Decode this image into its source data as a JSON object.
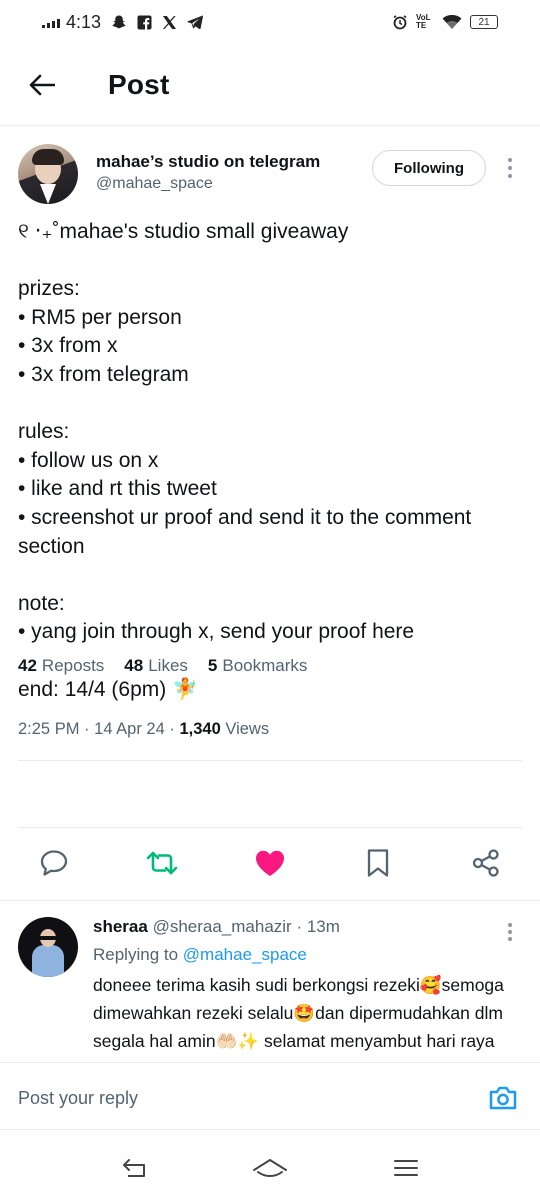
{
  "status_bar": {
    "time": "4:13",
    "notification_icons": [
      "snapchat-icon",
      "facebook-icon",
      "x-icon",
      "telegram-icon"
    ],
    "system_icons": [
      "alarm-icon",
      "volte-icon",
      "wifi-icon"
    ],
    "network_label": "VoLTE",
    "battery": "21"
  },
  "header": {
    "title": "Post"
  },
  "post": {
    "author_name": "mahae’s studio on telegram",
    "author_handle": "@mahae_space",
    "follow_label": "Following",
    "lines": [
      "୧ ‧₊˚mahae's studio small giveaway",
      "",
      "prizes:",
      "• RM5 per person",
      "• 3x from x",
      "• 3x from telegram",
      "",
      "rules:",
      "• follow us on x",
      "• like and rt this tweet",
      "• screenshot ur proof and send it to the comment section",
      "",
      "note:",
      "• yang join through x, send your proof here",
      "",
      "end: 14/4 (6pm) 🧚"
    ],
    "time": "2:25 PM",
    "date": "14 Apr 24",
    "views_count": "1,340",
    "views_label": "Views",
    "reposts_count": "42",
    "reposts_label": "Reposts",
    "likes_count": "48",
    "likes_label": "Likes",
    "bookmarks_count": "5",
    "bookmarks_label": "Bookmarks",
    "liked": true,
    "reposted": true
  },
  "colors": {
    "accent_blue": "#1d9bf0",
    "repost_green": "#00ba7c",
    "like_pink": "#f91880",
    "text_primary": "#0f1419",
    "text_secondary": "#536471"
  },
  "reply": {
    "name": "sheraa",
    "handle": "@sheraa_mahazir",
    "time": "· 13m",
    "replying_prefix": "Replying to",
    "replying_to": "@mahae_space",
    "text": "doneee terima kasih sudi berkongsi rezeki🥰semoga dimewahkan rezeki selalu🤩dan dipermudahkan dlm segala hal amin🤲🏻✨ selamat menyambut hari raya aidilfitri 🥳"
  },
  "reply_bar": {
    "placeholder": "Post your reply"
  }
}
